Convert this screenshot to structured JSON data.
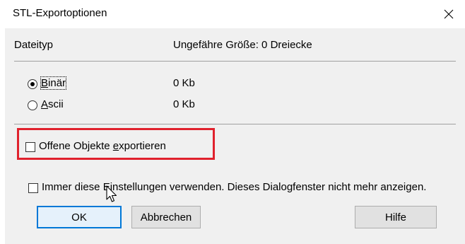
{
  "window": {
    "title": "STL-Exportoptionen"
  },
  "header": {
    "type_label": "Dateityp",
    "size_label": "Ungefähre Größe: 0 Dreiecke"
  },
  "format": {
    "options": [
      {
        "label_key": "B",
        "label_rest": "inär",
        "size": "0 Kb",
        "selected": true
      },
      {
        "label_key": "A",
        "label_rest": "scii",
        "size": "0 Kb",
        "selected": false
      }
    ]
  },
  "export_open": {
    "label_pre": "Offene Objekte ",
    "label_key": "e",
    "label_post": "xportieren",
    "checked": false
  },
  "always_use": {
    "label": "Immer diese Einstellungen verwenden. Dieses Dialogfenster nicht mehr anzeigen.",
    "checked": false
  },
  "buttons": {
    "ok": "OK",
    "cancel": "Abbrechen",
    "help": "Hilfe"
  },
  "colors": {
    "highlight": "#e0212d",
    "default_button_border": "#0078d7"
  }
}
